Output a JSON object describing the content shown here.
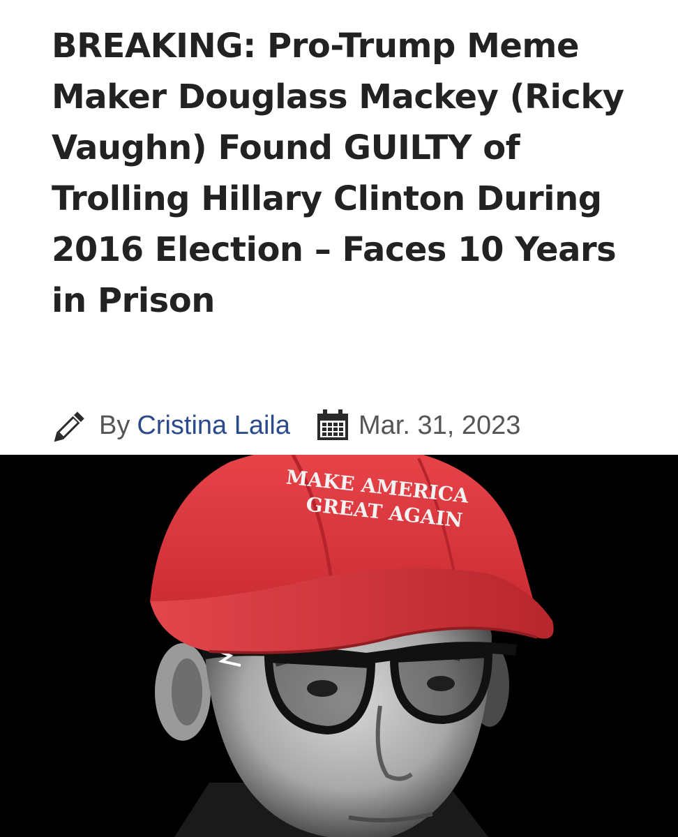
{
  "article": {
    "headline": "BREAKING: Pro-Trump Meme Maker Douglass Mackey (Ricky Vaughn) Found GUILTY of Trolling Hillary Clinton During 2016 Election – Faces 10 Years in Prison",
    "byline": {
      "prefix": "By",
      "author": "Cristina Laila",
      "date": "Mar. 31, 2023",
      "author_icon": "pencil-icon",
      "date_icon": "calendar-icon"
    },
    "photo": {
      "hat_line_1": "MAKE AMERICA",
      "hat_line_2": "GREAT AGAIN"
    }
  },
  "colors": {
    "headline_text": "#222222",
    "meta_text": "#555555",
    "author_link": "#2b4a8b",
    "hat_red": "#e5383d",
    "photo_background": "#000000"
  }
}
